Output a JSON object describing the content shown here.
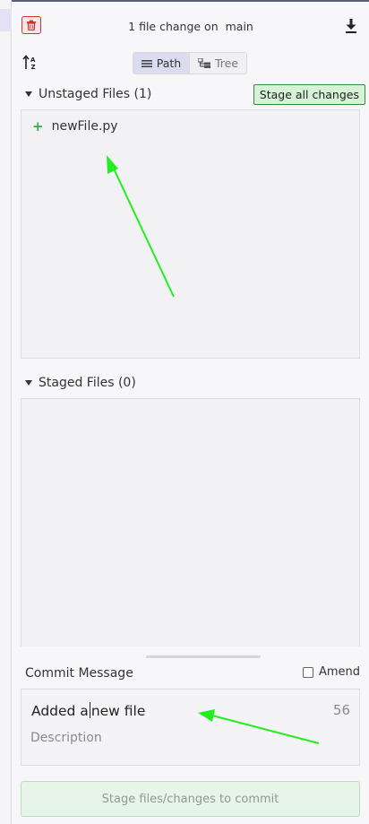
{
  "header": {
    "title": "1 file change on",
    "branch": "main"
  },
  "view_toggle": {
    "path_label": "Path",
    "tree_label": "Tree"
  },
  "unstaged": {
    "title": "Unstaged Files (1)",
    "stage_all_label": "Stage all changes",
    "files": [
      {
        "name": "newFile.py",
        "status_symbol": "+"
      }
    ]
  },
  "staged": {
    "title": "Staged Files (0)"
  },
  "commit": {
    "label": "Commit Message",
    "amend_label": "Amend",
    "summary_before_cursor": "Added a",
    "summary_after_cursor": "new file",
    "char_count": "56",
    "description_placeholder": "Description",
    "button_label": "Stage files/changes to commit"
  },
  "colors": {
    "accent_green": "#2fae46",
    "annotation_arrow": "#22ee22",
    "danger_red": "#cc3535"
  },
  "icons": [
    "trash-icon",
    "download-icon",
    "sort-icon",
    "list-icon",
    "tree-icon",
    "caret-down-icon",
    "plus-icon"
  ]
}
